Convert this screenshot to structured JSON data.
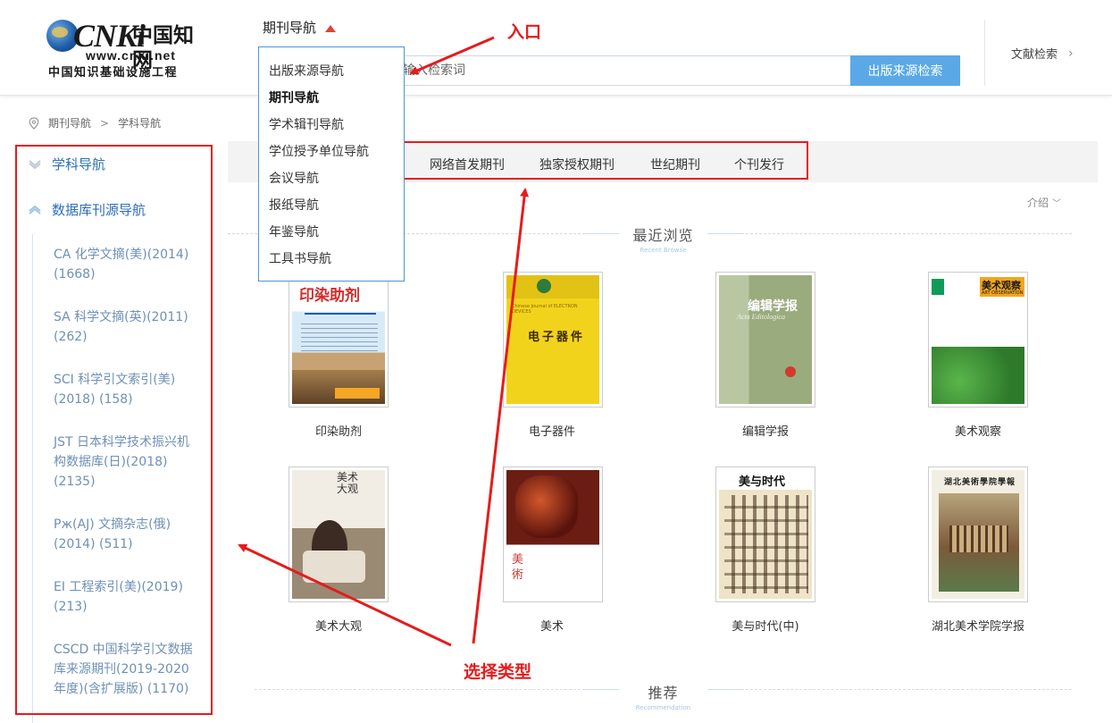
{
  "logo": {
    "mark": "CNKi",
    "cn_name": "中国知网",
    "url": "www.cnki.net",
    "tagline": "中国知识基础设施工程"
  },
  "header": {
    "nav_trigger": "期刊导航",
    "search_placeholder": "输入检索词",
    "search_button": "出版来源检索",
    "doc_search": "文献检索"
  },
  "dropdown": {
    "items": [
      "出版来源导航",
      "期刊导航",
      "学术辑刊导航",
      "学位授予单位导航",
      "会议导航",
      "报纸导航",
      "年鉴导航",
      "工具书导航"
    ],
    "active_index": 1
  },
  "breadcrumb": {
    "items": [
      "期刊导航",
      "学科导航"
    ],
    "separator": ">"
  },
  "sidebar": {
    "headers": [
      "学科导航",
      "数据库刊源导航"
    ],
    "items": [
      [
        "CA 化学文摘(美)(2014)",
        "(1668)"
      ],
      [
        "SA 科学文摘(英)(2011)",
        "(262)"
      ],
      [
        "SCI 科学引文索引(美)",
        "(2018) (158)"
      ],
      [
        "JST 日本科学技术振兴机",
        "构数据库(日)(2018)",
        "(2135)"
      ],
      [
        "Рж(AJ) 文摘杂志(俄)",
        "(2014) (511)"
      ],
      [
        "EI 工程索引(美)(2019)",
        "(213)"
      ],
      [
        "CSCD 中国科学引文数据",
        "库来源期刊(2019-2020",
        "年度)(含扩展版) (1170)"
      ]
    ]
  },
  "tabs": [
    "网络首发期刊",
    "独家授权期刊",
    "世纪期刊",
    "个刊发行"
  ],
  "intro": "介绍",
  "sections": {
    "recent": {
      "cn": "最近浏览",
      "en": "Recent Browse"
    },
    "recommend": {
      "cn": "推荐",
      "en": "Recommendation"
    }
  },
  "journals": [
    {
      "name": "印染助剂",
      "cover_title": "印染助剂"
    },
    {
      "name": "电子器件",
      "cover_title": "电子器件",
      "cover_en": "Chinese Journal of ELECTRON DEVICES"
    },
    {
      "name": "编辑学报",
      "cover_title": "编辑学报",
      "cover_en": "Acta Editologica"
    },
    {
      "name": "美术观察",
      "cover_title": "美术观察",
      "cover_en": "ART OBSERVATION"
    },
    {
      "name": "美术大观",
      "cover_title": "美术大观"
    },
    {
      "name": "美术",
      "cover_title": "美術"
    },
    {
      "name": "美与时代(中)",
      "cover_title": "美与时代"
    },
    {
      "name": "湖北美术学院学报",
      "cover_title": "湖北美術學院學報"
    }
  ],
  "annotations": {
    "entry": "入口",
    "choose_type": "选择类型"
  },
  "colors": {
    "accent_blue": "#5aa9e6",
    "link_blue": "#2d6fb6",
    "annotation_red": "#e51c1c"
  }
}
